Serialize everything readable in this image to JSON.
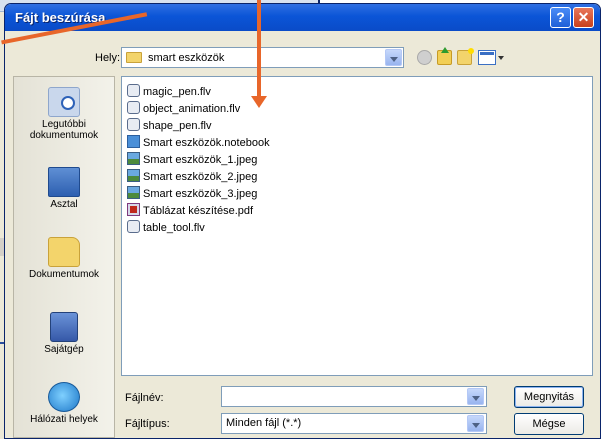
{
  "dialog": {
    "title": "Fájt beszúrása"
  },
  "toolbar": {
    "look_in_label": "Hely:",
    "look_in_value": "smart eszközök"
  },
  "places": [
    {
      "label": "Legutóbbi dokumentumok",
      "icon": "recent-documents-icon"
    },
    {
      "label": "Asztal",
      "icon": "desktop-icon"
    },
    {
      "label": "Dokumentumok",
      "icon": "my-documents-icon"
    },
    {
      "label": "Sajátgép",
      "icon": "my-computer-icon"
    },
    {
      "label": "Hálózati helyek",
      "icon": "network-places-icon"
    }
  ],
  "files": [
    {
      "name": "magic_pen.flv",
      "type": "flv"
    },
    {
      "name": "object_animation.flv",
      "type": "flv"
    },
    {
      "name": "shape_pen.flv",
      "type": "flv"
    },
    {
      "name": "Smart eszközök.notebook",
      "type": "notebook"
    },
    {
      "name": "Smart eszközök_1.jpeg",
      "type": "jpeg"
    },
    {
      "name": "Smart eszközök_2.jpeg",
      "type": "jpeg"
    },
    {
      "name": "Smart eszközök_3.jpeg",
      "type": "jpeg"
    },
    {
      "name": "Táblázat készítése.pdf",
      "type": "pdf"
    },
    {
      "name": "table_tool.flv",
      "type": "flv"
    }
  ],
  "filename": {
    "label": "Fájlnév:",
    "value": ""
  },
  "filetype": {
    "label": "Fájltípus:",
    "value": "Minden fájl (*.*)"
  },
  "buttons": {
    "open": "Megnyitás",
    "cancel": "Mégse"
  },
  "colors": {
    "annotation_arrow": "#e8662a",
    "titlebar": "#0b55d7"
  }
}
